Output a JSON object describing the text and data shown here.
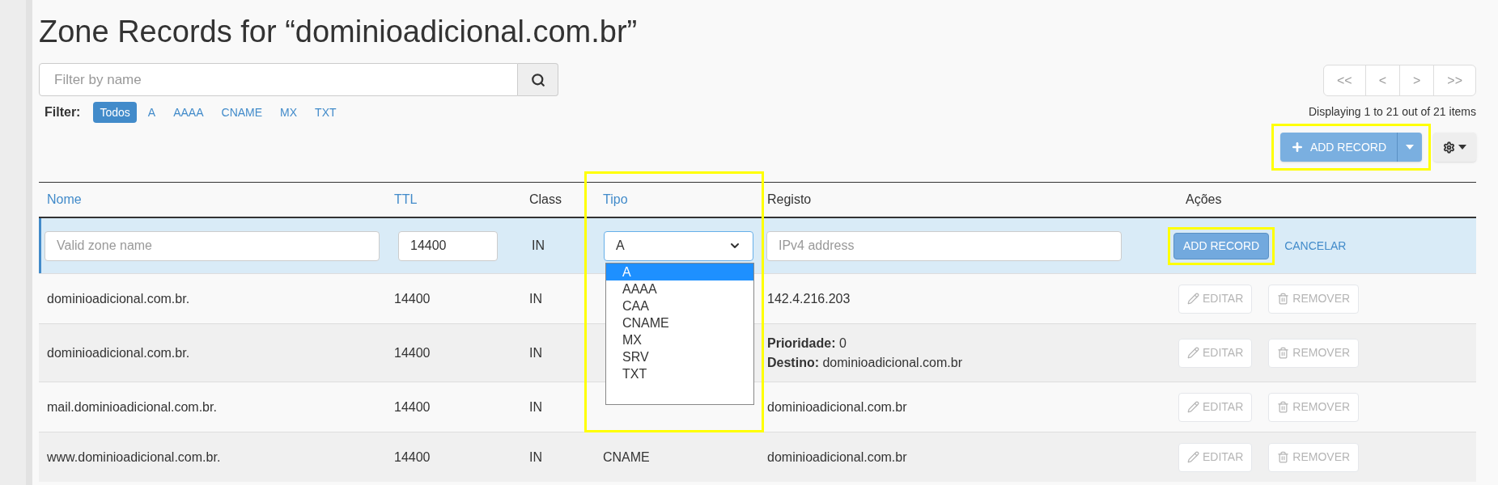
{
  "title": "Zone Records for “dominioadicional.com.br”",
  "search": {
    "placeholder": "Filter by name"
  },
  "filter": {
    "label": "Filter:",
    "options": [
      {
        "label": "Todos",
        "selected": true
      },
      {
        "label": "A",
        "selected": false
      },
      {
        "label": "AAAA",
        "selected": false
      },
      {
        "label": "CNAME",
        "selected": false
      },
      {
        "label": "MX",
        "selected": false
      },
      {
        "label": "TXT",
        "selected": false
      }
    ]
  },
  "pagination": {
    "buttons": [
      "<<",
      "<",
      ">",
      ">>"
    ],
    "summary": "Displaying 1 to 21 out of 21 items"
  },
  "add_record": {
    "label": "ADD RECORD",
    "highlighted": true
  },
  "table": {
    "columns": [
      {
        "label": "Nome",
        "sortable": true,
        "highlighted": false
      },
      {
        "label": "TTL",
        "sortable": true,
        "highlighted": false
      },
      {
        "label": "Class",
        "sortable": false,
        "highlighted": false
      },
      {
        "label": "Tipo",
        "sortable": true,
        "highlighted": true
      },
      {
        "label": "Registo",
        "sortable": false,
        "highlighted": false
      },
      {
        "label": "Ações",
        "sortable": false,
        "highlighted": false
      }
    ],
    "new_row": {
      "name_placeholder": "Valid zone name",
      "ttl": "14400",
      "class": "IN",
      "type_select": {
        "value": "A",
        "expanded": true,
        "options": [
          {
            "label": "A",
            "selected": true
          },
          {
            "label": "AAAA",
            "selected": false
          },
          {
            "label": "CAA",
            "selected": false
          },
          {
            "label": "CNAME",
            "selected": false
          },
          {
            "label": "MX",
            "selected": false
          },
          {
            "label": "SRV",
            "selected": false
          },
          {
            "label": "TXT",
            "selected": false
          }
        ]
      },
      "record_placeholder": "IPv4 address",
      "add_button": {
        "label": "ADD RECORD",
        "highlighted": true
      },
      "cancel": "CANCELAR"
    },
    "rows": [
      {
        "name": "dominioadicional.com.br.",
        "ttl": "14400",
        "class": "IN",
        "record": [
          "142.4.216.203"
        ],
        "actions": [
          {
            "kind": "edit",
            "label": "EDITAR",
            "disabled": true
          },
          {
            "kind": "remove",
            "label": "REMOVER",
            "disabled": true
          }
        ]
      },
      {
        "name": "dominioadicional.com.br.",
        "ttl": "14400",
        "class": "IN",
        "record": [
          "**Prioridade:** 0",
          "**Destino:** dominioadicional.com.br"
        ],
        "actions": [
          {
            "kind": "edit",
            "label": "EDITAR",
            "disabled": true
          },
          {
            "kind": "remove",
            "label": "REMOVER",
            "disabled": true
          }
        ]
      },
      {
        "name": "mail.dominioadicional.com.br.",
        "ttl": "14400",
        "class": "IN",
        "record": [
          "dominioadicional.com.br"
        ],
        "actions": [
          {
            "kind": "edit",
            "label": "EDITAR",
            "disabled": true
          },
          {
            "kind": "remove",
            "label": "REMOVER",
            "disabled": true
          }
        ]
      },
      {
        "name": "www.dominioadicional.com.br.",
        "ttl": "14400",
        "class": "IN",
        "type": "CNAME",
        "record": [
          "dominioadicional.com.br"
        ],
        "actions": [
          {
            "kind": "edit",
            "label": "EDITAR",
            "disabled": true
          },
          {
            "kind": "remove",
            "label": "REMOVER",
            "disabled": true
          }
        ]
      }
    ]
  }
}
